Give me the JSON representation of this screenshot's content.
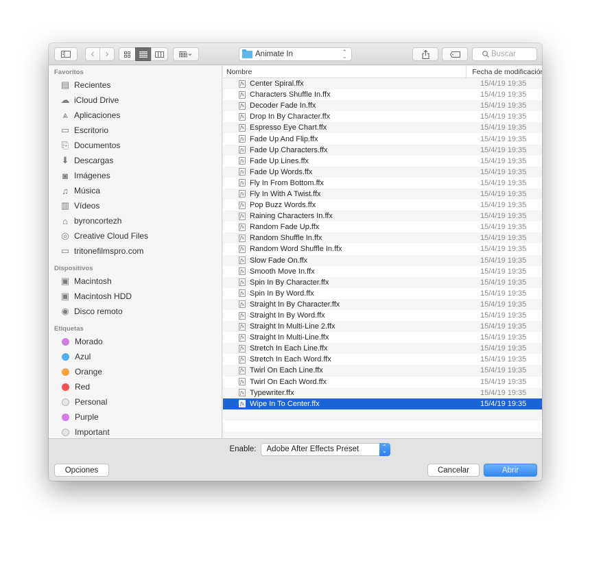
{
  "toolbar": {
    "location": "Animate In",
    "search_placeholder": "Buscar",
    "icons": {
      "sidebar_toggle": "sidebar-icon",
      "back": "‹",
      "forward": "›",
      "icon_view": "grid-icon",
      "list_view": "list-icon",
      "column_view": "columns-icon",
      "group": "group-icon",
      "share": "share-icon",
      "tags": "tag-icon",
      "search": "search-icon"
    }
  },
  "sidebar": {
    "favorites_title": "Favoritos",
    "favorites": [
      {
        "label": "Recientes",
        "icon": "recents-icon"
      },
      {
        "label": "iCloud Drive",
        "icon": "cloud-icon"
      },
      {
        "label": "Aplicaciones",
        "icon": "applications-icon"
      },
      {
        "label": "Escritorio",
        "icon": "desktop-icon"
      },
      {
        "label": "Documentos",
        "icon": "documents-icon"
      },
      {
        "label": "Descargas",
        "icon": "downloads-icon"
      },
      {
        "label": "Imágenes",
        "icon": "camera-icon"
      },
      {
        "label": "Música",
        "icon": "music-icon"
      },
      {
        "label": "Vídeos",
        "icon": "film-icon"
      },
      {
        "label": "byroncortezh",
        "icon": "home-icon"
      },
      {
        "label": "Creative Cloud Files",
        "icon": "creative-cloud-icon"
      },
      {
        "label": "tritonefilmspro.com",
        "icon": "folder-icon"
      }
    ],
    "devices_title": "Dispositivos",
    "devices": [
      {
        "label": "Macintosh",
        "icon": "disk-icon"
      },
      {
        "label": "Macintosh HDD",
        "icon": "disk-icon"
      },
      {
        "label": "Disco remoto",
        "icon": "optical-disc-icon"
      }
    ],
    "tags_title": "Etiquetas",
    "tags": [
      {
        "label": "Morado",
        "color": "#cf7fe0"
      },
      {
        "label": "Azul",
        "color": "#4fb0f5"
      },
      {
        "label": "Orange",
        "color": "#f9a23f"
      },
      {
        "label": "Red",
        "color": "#f75050"
      },
      {
        "label": "Personal",
        "color": "#e6e6e6"
      },
      {
        "label": "Purple",
        "color": "#cf7fe0"
      },
      {
        "label": "Important",
        "color": "#e6e6e6"
      }
    ]
  },
  "filelist": {
    "col_name": "Nombre",
    "col_date": "Fecha de modificación",
    "selected_index": 29,
    "selected_color": "#1b64d6",
    "files": [
      {
        "name": "Center Spiral.ffx",
        "date": "15/4/19 19:35"
      },
      {
        "name": "Characters Shuffle In.ffx",
        "date": "15/4/19 19:35"
      },
      {
        "name": "Decoder Fade In.ffx",
        "date": "15/4/19 19:35"
      },
      {
        "name": "Drop In By Character.ffx",
        "date": "15/4/19 19:35"
      },
      {
        "name": "Espresso Eye Chart.ffx",
        "date": "15/4/19 19:35"
      },
      {
        "name": "Fade Up And Flip.ffx",
        "date": "15/4/19 19:35"
      },
      {
        "name": "Fade Up Characters.ffx",
        "date": "15/4/19 19:35"
      },
      {
        "name": "Fade Up Lines.ffx",
        "date": "15/4/19 19:35"
      },
      {
        "name": "Fade Up Words.ffx",
        "date": "15/4/19 19:35"
      },
      {
        "name": "Fly In From Bottom.ffx",
        "date": "15/4/19 19:35"
      },
      {
        "name": "Fly In With A Twist.ffx",
        "date": "15/4/19 19:35"
      },
      {
        "name": "Pop Buzz Words.ffx",
        "date": "15/4/19 19:35"
      },
      {
        "name": "Raining Characters In.ffx",
        "date": "15/4/19 19:35"
      },
      {
        "name": "Random Fade Up.ffx",
        "date": "15/4/19 19:35"
      },
      {
        "name": "Random Shuffle In.ffx",
        "date": "15/4/19 19:35"
      },
      {
        "name": "Random Word Shuffle In.ffx",
        "date": "15/4/19 19:35"
      },
      {
        "name": "Slow Fade On.ffx",
        "date": "15/4/19 19:35"
      },
      {
        "name": "Smooth Move In.ffx",
        "date": "15/4/19 19:35"
      },
      {
        "name": "Spin In By Character.ffx",
        "date": "15/4/19 19:35"
      },
      {
        "name": "Spin In By Word.ffx",
        "date": "15/4/19 19:35"
      },
      {
        "name": "Straight In By Character.ffx",
        "date": "15/4/19 19:35"
      },
      {
        "name": "Straight In By Word.ffx",
        "date": "15/4/19 19:35"
      },
      {
        "name": "Straight In Multi-Line 2.ffx",
        "date": "15/4/19 19:35"
      },
      {
        "name": "Straight In Multi-Line.ffx",
        "date": "15/4/19 19:35"
      },
      {
        "name": "Stretch In Each Line.ffx",
        "date": "15/4/19 19:35"
      },
      {
        "name": "Stretch In Each Word.ffx",
        "date": "15/4/19 19:35"
      },
      {
        "name": "Twirl On Each Line.ffx",
        "date": "15/4/19 19:35"
      },
      {
        "name": "Twirl On Each Word.ffx",
        "date": "15/4/19 19:35"
      },
      {
        "name": "Typewriter.ffx",
        "date": "15/4/19 19:35"
      },
      {
        "name": "Wipe In To Center.ffx",
        "date": "15/4/19 19:35"
      }
    ]
  },
  "footer": {
    "enable_label": "Enable:",
    "enable_value": "Adobe After Effects Preset",
    "options_label": "Opciones",
    "cancel_label": "Cancelar",
    "open_label": "Abrir"
  }
}
